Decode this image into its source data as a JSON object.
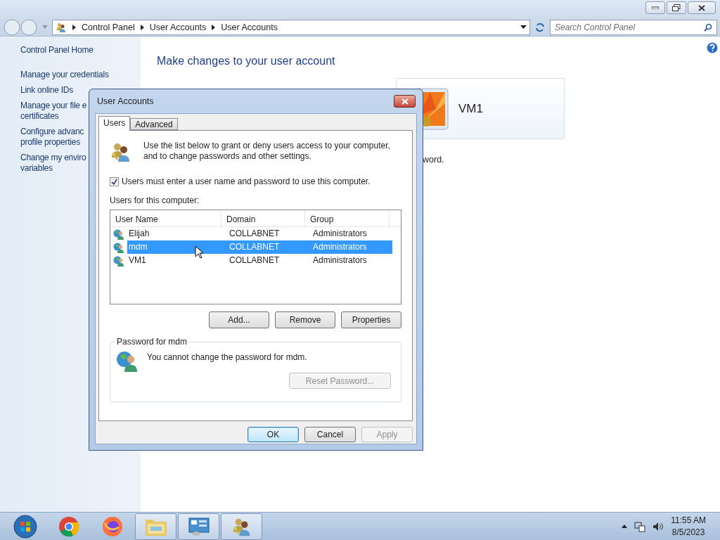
{
  "address_bar": {
    "breadcrumbs": [
      "Control Panel",
      "User Accounts",
      "User Accounts"
    ]
  },
  "search": {
    "placeholder": "Search Control Panel"
  },
  "sidebar": {
    "items": [
      {
        "lines": [
          "Control Panel Home"
        ],
        "kind": "home"
      },
      {
        "lines": [
          "Manage your credentials"
        ],
        "kind": "link"
      },
      {
        "lines": [
          "Link online IDs"
        ],
        "kind": "link"
      },
      {
        "lines": [
          "Manage your file e",
          "certificates"
        ],
        "kind": "link"
      },
      {
        "lines": [
          "Configure advanc",
          "profile properties"
        ],
        "kind": "link"
      },
      {
        "lines": [
          "Change my enviro",
          "variables"
        ],
        "kind": "link"
      }
    ]
  },
  "main": {
    "heading": "Make changes to your user account",
    "account_name": "VM1",
    "partial_text": "word."
  },
  "dialog": {
    "title": "User Accounts",
    "tabs": [
      {
        "label": "Users",
        "selected": true
      },
      {
        "label": "Advanced",
        "selected": false
      }
    ],
    "intro": "Use the list below to grant or deny users access to your computer, and to change passwords and other settings.",
    "require_login": {
      "label": "Users must enter a user name and password to use this computer.",
      "checked": true
    },
    "list_label": "Users for this computer:",
    "table": {
      "columns": [
        "User Name",
        "Domain",
        "Group"
      ],
      "rows": [
        {
          "cells": [
            "Elijah",
            "COLLABNET",
            "Administrators"
          ],
          "selected": false
        },
        {
          "cells": [
            "mdm",
            "COLLABNET",
            "Administrators"
          ],
          "selected": true
        },
        {
          "cells": [
            "VM1",
            "COLLABNET",
            "Administrators"
          ],
          "selected": false
        }
      ]
    },
    "buttons": [
      {
        "label": "Add...",
        "disabled": false
      },
      {
        "label": "Remove",
        "disabled": false
      },
      {
        "label": "Properties",
        "disabled": false
      }
    ],
    "password_group": {
      "title": "Password for mdm",
      "message": "You cannot change the password for mdm.",
      "button": {
        "label": "Reset Password...",
        "disabled": true
      }
    },
    "footer_buttons": [
      {
        "label": "OK",
        "default": true,
        "disabled": false
      },
      {
        "label": "Cancel",
        "default": false,
        "disabled": false
      },
      {
        "label": "Apply",
        "default": false,
        "disabled": true
      }
    ]
  },
  "taskbar": {
    "time": "11:55 AM",
    "date": "8/5/2023"
  }
}
